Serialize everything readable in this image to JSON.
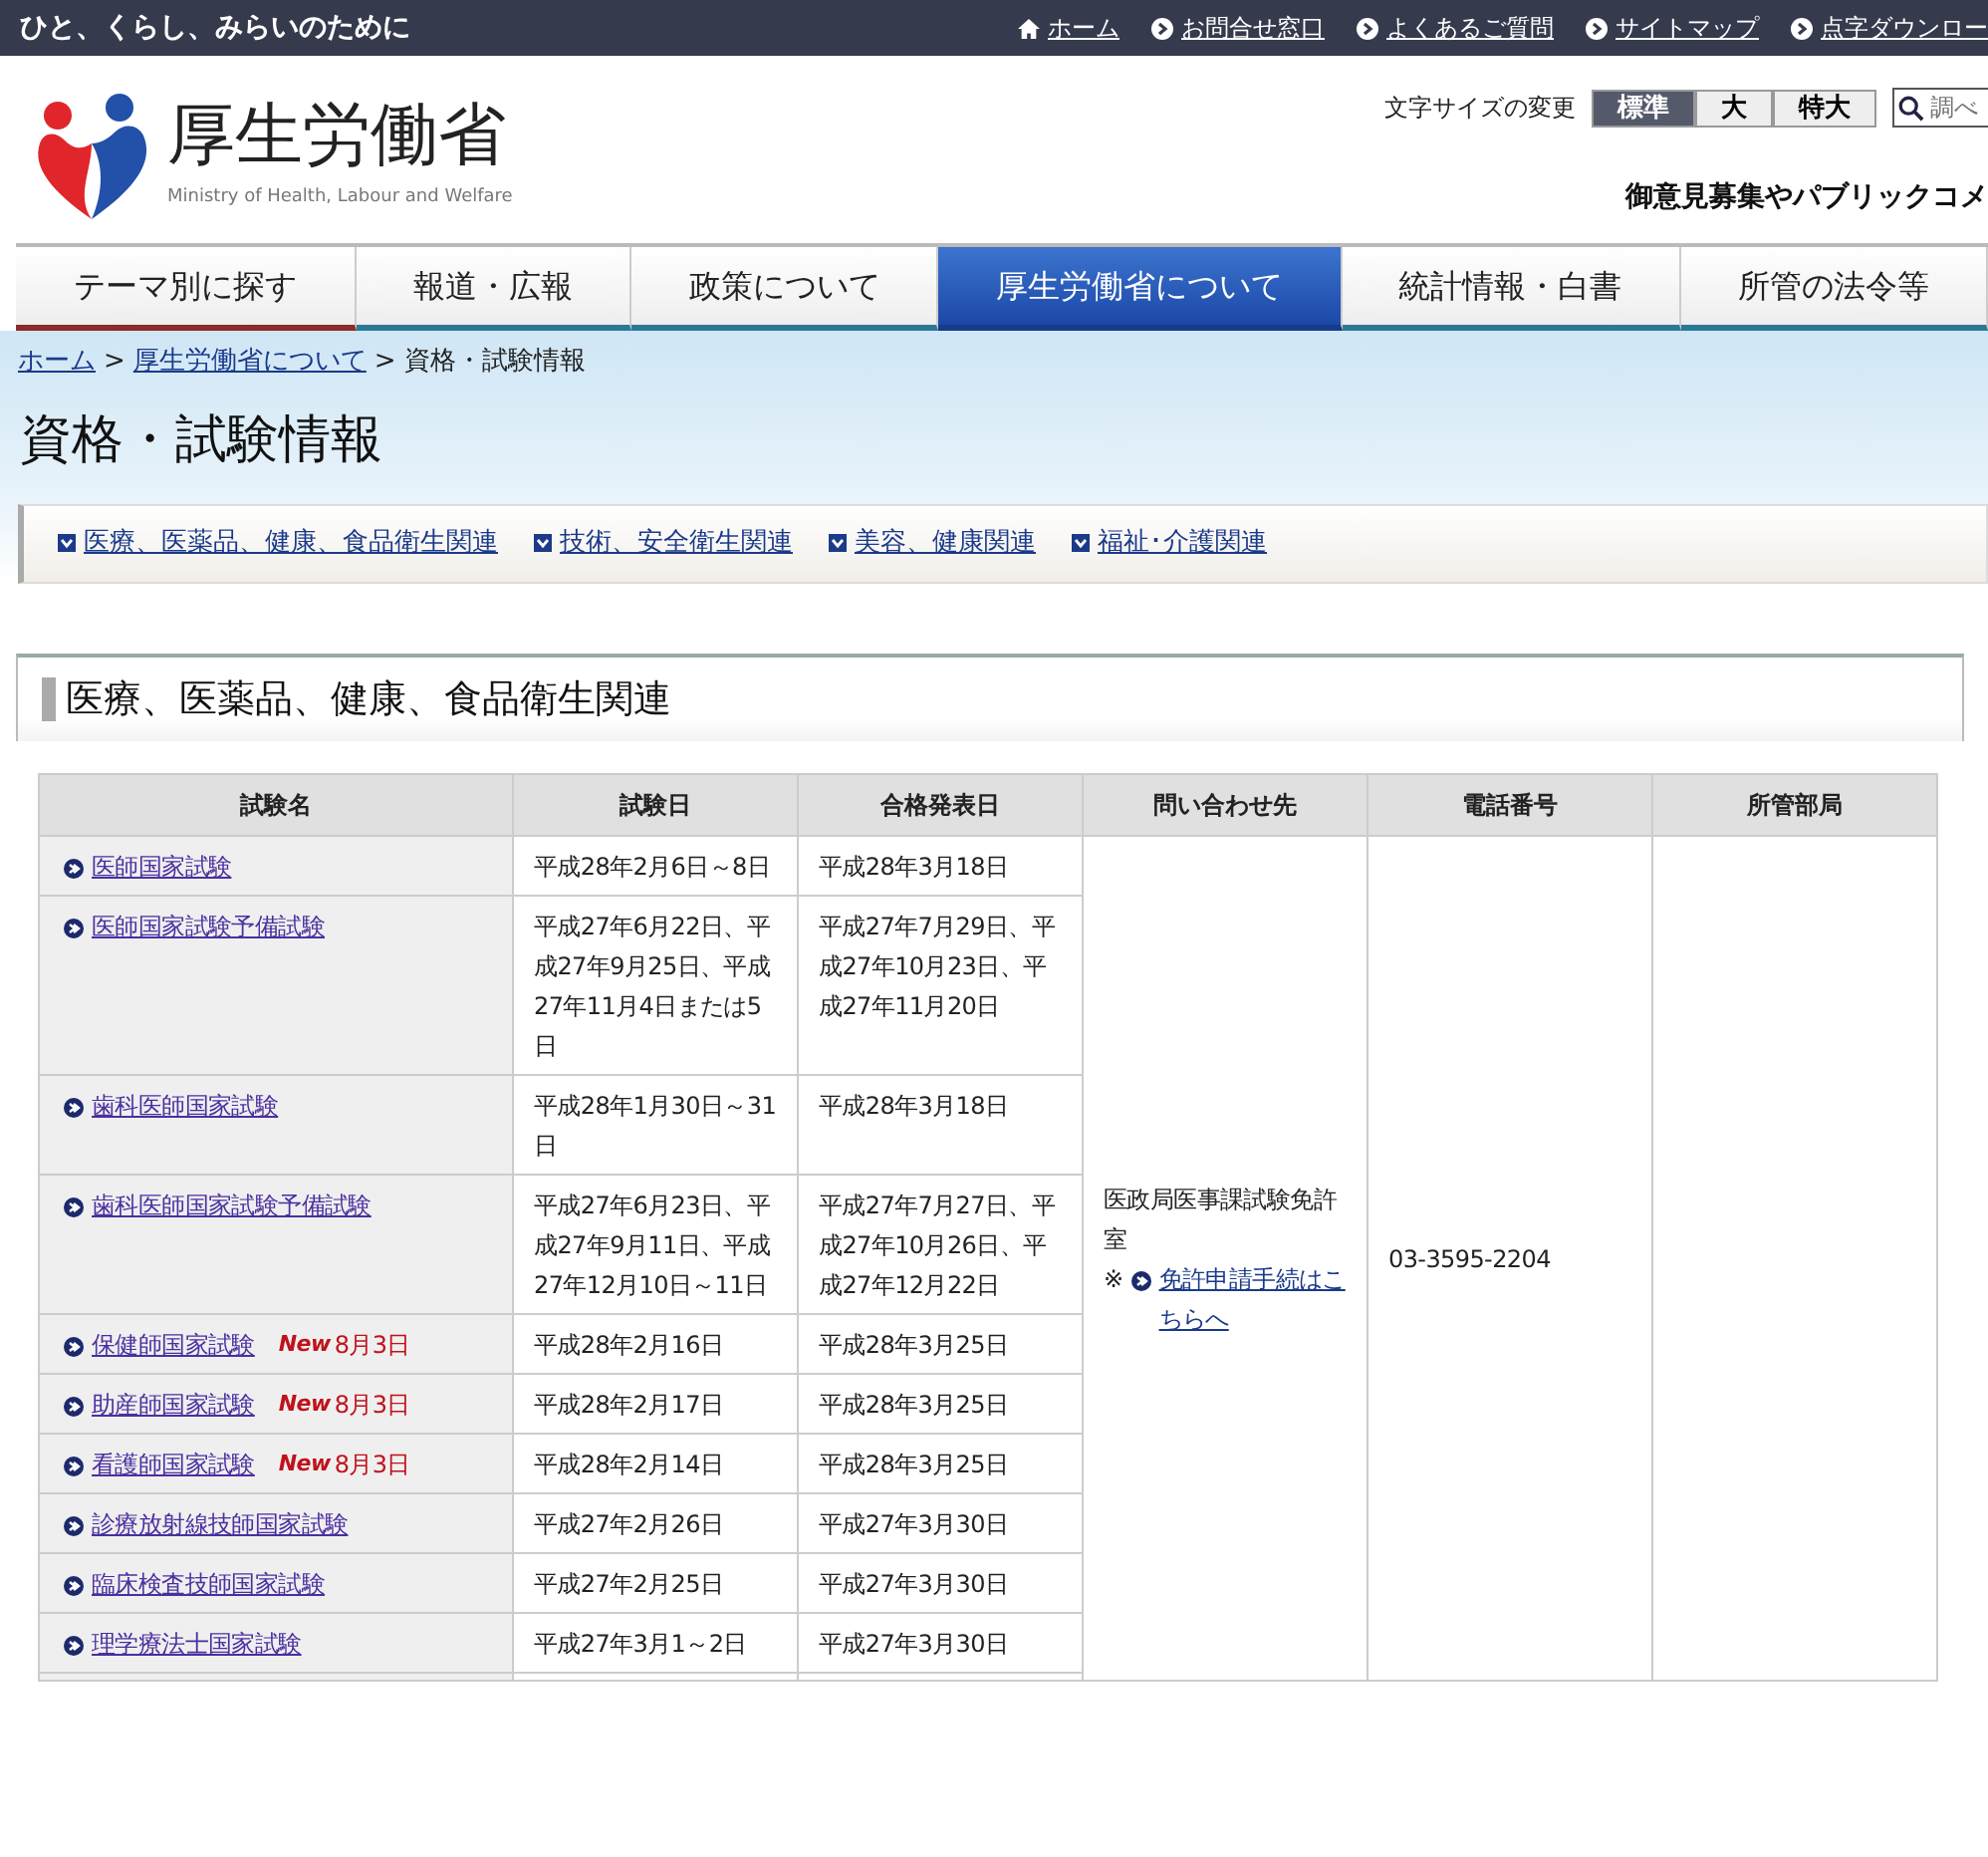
{
  "top_bar": {
    "tagline": "ひと、くらし、みらいのために",
    "links": [
      {
        "kind": "home",
        "label": "ホーム"
      },
      {
        "kind": "arrow",
        "label": "お問合せ窓口"
      },
      {
        "kind": "arrow",
        "label": "よくあるご質問"
      },
      {
        "kind": "arrow",
        "label": "サイトマップ"
      },
      {
        "kind": "arrow",
        "label": "点字ダウンロー"
      }
    ]
  },
  "header": {
    "logo_title": "厚生労働省",
    "logo_subtitle": "Ministry of Health, Labour and Welfare",
    "font_size_label": "文字サイズの変更",
    "font_sizes": [
      {
        "label": "標準",
        "selected": true
      },
      {
        "label": "大",
        "selected": false
      },
      {
        "label": "特大",
        "selected": false
      }
    ],
    "search": {
      "placeholder": "調べ"
    },
    "feature_link": "御意見募集やパブリックコメ"
  },
  "nav_tabs": [
    {
      "label": "テーマ別に探す",
      "selected": false
    },
    {
      "label": "報道・広報",
      "selected": false
    },
    {
      "label": "政策について",
      "selected": false
    },
    {
      "label": "厚生労働省について",
      "selected": true
    },
    {
      "label": "統計情報・白書",
      "selected": false
    },
    {
      "label": "所管の法令等",
      "selected": false
    }
  ],
  "breadcrumb": {
    "separator": ">",
    "items": [
      "ホーム",
      "厚生労働省について",
      "資格・試験情報"
    ]
  },
  "page_title": "資格・試験情報",
  "anchor_links": [
    "医療、医薬品、健康、食品衛生関連",
    "技術、安全衛生関連",
    "美容、健康関連",
    "福祉･介護関連"
  ],
  "section": {
    "heading": "医療、医薬品、健康、食品衛生関連",
    "table": {
      "columns": [
        "試験名",
        "試験日",
        "合格発表日",
        "問い合わせ先",
        "電話番号",
        "所管部局"
      ],
      "rows": [
        {
          "name": "医師国家試験",
          "exam_date": "平成28年2月6日～8日",
          "result_date": "平成28年3月18日"
        },
        {
          "name": "医師国家試験予備試験",
          "exam_date": "平成27年6月22日、平成27年9月25日、平成27年11月4日または5日",
          "result_date": "平成27年7月29日、平成27年10月23日、平成27年11月20日"
        },
        {
          "name": "歯科医師国家試験",
          "exam_date": "平成28年1月30日～31日",
          "result_date": "平成28年3月18日"
        },
        {
          "name": "歯科医師国家試験予備試験",
          "exam_date": "平成27年6月23日、平成27年9月11日、平成27年12月10日～11日",
          "result_date": "平成27年7月27日、平成27年10月26日、平成27年12月22日"
        },
        {
          "name": "保健師国家試験",
          "badge": "New",
          "badge_date": "8月3日",
          "exam_date": "平成28年2月16日",
          "result_date": "平成28年3月25日"
        },
        {
          "name": "助産師国家試験",
          "badge": "New",
          "badge_date": "8月3日",
          "exam_date": "平成28年2月17日",
          "result_date": "平成28年3月25日"
        },
        {
          "name": "看護師国家試験",
          "badge": "New",
          "badge_date": "8月3日",
          "exam_date": "平成28年2月14日",
          "result_date": "平成28年3月25日"
        },
        {
          "name": "診療放射線技師国家試験",
          "exam_date": "平成27年2月26日",
          "result_date": "平成27年3月30日"
        },
        {
          "name": "臨床検査技師国家試験",
          "exam_date": "平成27年2月25日",
          "result_date": "平成27年3月30日"
        },
        {
          "name": "理学療法士国家試験",
          "exam_date": "平成27年3月1～2日",
          "result_date": "平成27年3月30日"
        }
      ],
      "contact": {
        "department": "医政局医事課試験免許室",
        "note_mark": "※",
        "link": "免許申請手続はこちらへ"
      },
      "phone": "03-3595-2204"
    }
  }
}
